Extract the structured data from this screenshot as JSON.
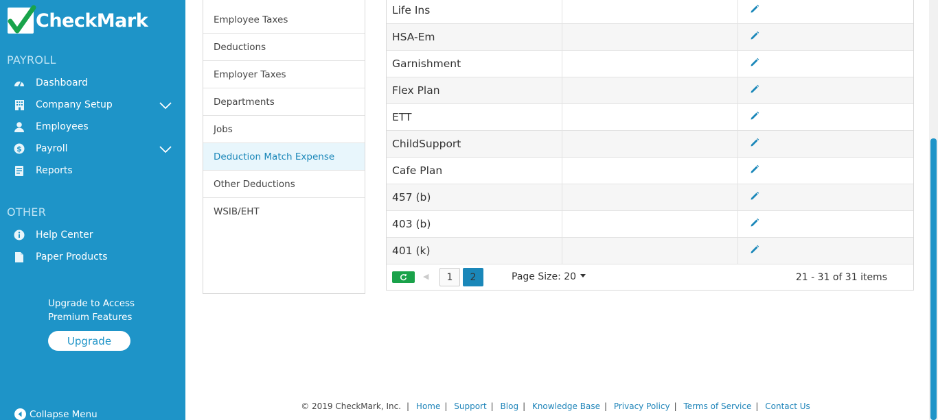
{
  "brand": {
    "name": "CheckMark"
  },
  "colors": {
    "sidebar": "#1e94c8",
    "accent": "#1a87b9",
    "refresh": "#1aa24a"
  },
  "sidebar": {
    "payroll_title": "PAYROLL",
    "payroll_items": [
      {
        "label": "Dashboard",
        "icon": "dashboard-icon"
      },
      {
        "label": "Company Setup",
        "icon": "building-icon",
        "expandable": true
      },
      {
        "label": "Employees",
        "icon": "user-icon"
      },
      {
        "label": "Payroll",
        "icon": "dollar-icon",
        "expandable": true
      },
      {
        "label": "Reports",
        "icon": "report-icon"
      }
    ],
    "other_title": "OTHER",
    "other_items": [
      {
        "label": "Help Center",
        "icon": "info-icon"
      },
      {
        "label": "Paper Products",
        "icon": "file-icon"
      }
    ],
    "upgrade_line1": "Upgrade to Access",
    "upgrade_line2": "Premium Features",
    "upgrade_button": "Upgrade",
    "collapse_label": "Collapse Menu"
  },
  "menu": {
    "items": [
      {
        "label": "Employee Taxes"
      },
      {
        "label": "Deductions"
      },
      {
        "label": "Employer Taxes"
      },
      {
        "label": "Departments"
      },
      {
        "label": "Jobs"
      },
      {
        "label": "Deduction Match Expense",
        "active": true
      },
      {
        "label": "Other Deductions"
      },
      {
        "label": "WSIB/EHT"
      }
    ]
  },
  "table": {
    "rows": [
      {
        "name": "Life Ins",
        "value": ""
      },
      {
        "name": "HSA-Em",
        "value": ""
      },
      {
        "name": "Garnishment",
        "value": ""
      },
      {
        "name": "Flex Plan",
        "value": ""
      },
      {
        "name": "ETT",
        "value": ""
      },
      {
        "name": "ChildSupport",
        "value": ""
      },
      {
        "name": "Cafe Plan",
        "value": ""
      },
      {
        "name": "457 (b)",
        "value": ""
      },
      {
        "name": "403 (b)",
        "value": ""
      },
      {
        "name": "401 (k)",
        "value": ""
      }
    ],
    "pager": {
      "pages": [
        "1",
        "2"
      ],
      "current_page": "2",
      "page_size_label": "Page Size: 20",
      "items_info": "21 - 31 of 31 items"
    }
  },
  "footer": {
    "copyright": "© 2019 CheckMark, Inc.",
    "links": [
      "Home",
      "Support",
      "Blog",
      "Knowledge Base",
      "Privacy Policy",
      "Terms of Service",
      "Contact Us"
    ]
  }
}
